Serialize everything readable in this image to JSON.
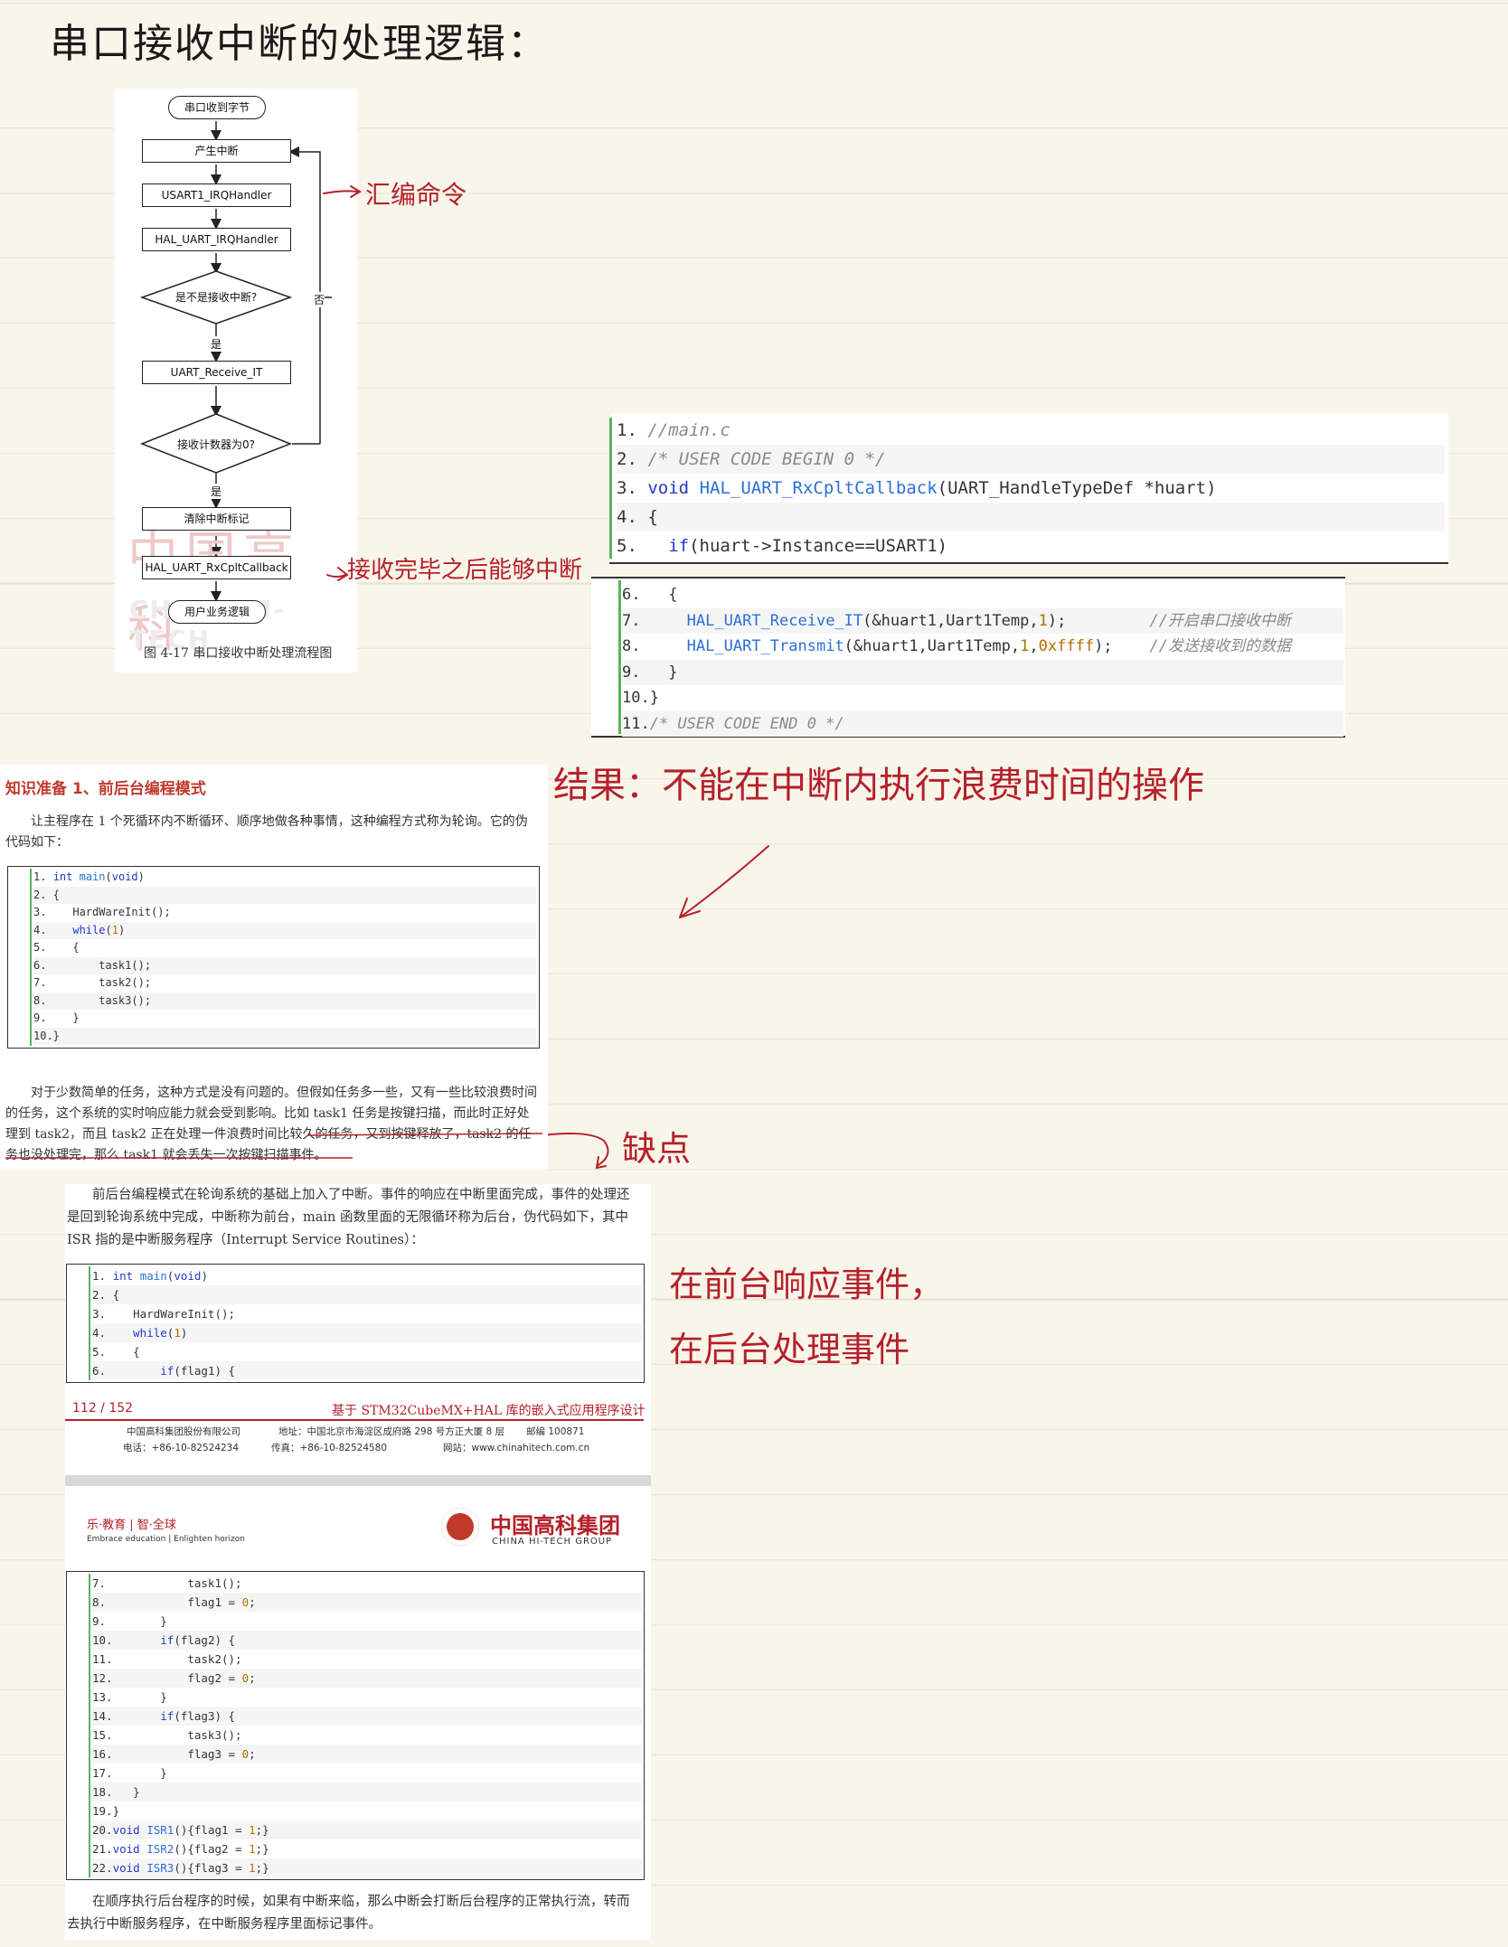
{
  "handwriting": {
    "title": "串口接收中断的处理逻辑：",
    "note_asm": "汇编命令",
    "note_callback": "接收完毕之后能够中断",
    "conclusion": "结果：不能在中断内执行浪费时间的操作",
    "note_cons": "缺点",
    "note_front": "在前台响应事件，",
    "note_back": "在后台处理事件"
  },
  "flowchart": {
    "nodes": [
      "串口收到字节",
      "产生中断",
      "USART1_IRQHandler",
      "HAL_UART_IRQHandler",
      "是不是接收中断?",
      "UART_Receive_IT",
      "接收计数器为0?",
      "清除中断标记",
      "HAL_UART_RxCpltCallback",
      "用户业务逻辑"
    ],
    "yes": "是",
    "no": "否",
    "caption": "图 4-17 串口接收中断处理流程图",
    "watermark1": "中国高科",
    "watermark2": "CHINA HI-TECH"
  },
  "code_main": {
    "lines": [
      {
        "n": "1.",
        "t": "//main.c"
      },
      {
        "n": "2.",
        "t": "/* USER CODE BEGIN 0 */"
      },
      {
        "n": "3.",
        "t": "void HAL_UART_RxCpltCallback(UART_HandleTypeDef *huart)"
      },
      {
        "n": "4.",
        "t": "{"
      },
      {
        "n": "5.",
        "t": "  if(huart->Instance==USART1)"
      },
      {
        "n": "6.",
        "t": "  {"
      },
      {
        "n": "7.",
        "t": "      HAL_UART_Receive_IT(&huart1,Uart1Temp,1);",
        "c": "//开启串口接收中断"
      },
      {
        "n": "8.",
        "t": "      HAL_UART_Transmit(&huart1,Uart1Temp,1,0xffff);",
        "c": "//发送接收到的数据"
      },
      {
        "n": "9.",
        "t": "  }"
      },
      {
        "n": "10.",
        "t": "}"
      },
      {
        "n": "11.",
        "t": "/* USER CODE END 0 */"
      }
    ]
  },
  "section": {
    "heading": "知识准备 1、前后台编程模式",
    "p1": "让主程序在 1 个死循环内不断循环、顺序地做各种事情，这种编程方式称为轮询。它的伪代码如下：",
    "p2": "对于少数简单的任务，这种方式是没有问题的。但假如任务多一些，又有一些比较浪费时间的任务，这个系统的实时响应能力就会受到影响。比如 task1 任务是按键扫描，而此时正好处理到 task2，而且 task2 正在处理一件浪费时间比较久的任务，又到按键释放了，task2 的任务也没处理完，那么 task1 就会丢失一次按键扫描事件。",
    "p3": "前后台编程模式在轮询系统的基础上加入了中断。事件的响应在中断里面完成，事件的处理还是回到轮询系统中完成，中断称为前台，main 函数里面的无限循环称为后台，伪代码如下，其中 ISR 指的是中断服务程序（Interrupt Service Routines）：",
    "p4": "在顺序执行后台程序的时候，如果有中断来临，那么中断会打断后台程序的正常执行流，转而去执行中断服务程序，在中断服务程序里面标记事件。"
  },
  "code_poll": [
    "1. int main(void)",
    "2. {",
    "3.    HardWareInit();",
    "4.    while(1)",
    "5.    {",
    "6.        task1();",
    "7.        task2();",
    "8.        task3();",
    "9.    }",
    "10.}"
  ],
  "code_fb1": [
    "1. int main(void)",
    "2. {",
    "3.    HardWareInit();",
    "4.    while(1)",
    "5.    {",
    "6.        if(flag1) {"
  ],
  "code_fb2": [
    "7.            task1();",
    "8.            flag1 = 0;",
    "9.        }",
    "10.       if(flag2) {",
    "11.           task2();",
    "12.           flag2 = 0;",
    "13.       }",
    "14.       if(flag3) {",
    "15.           task3();",
    "16.           flag3 = 0;",
    "17.       }",
    "18.   }",
    "19.}",
    "20.void ISR1(){flag1 = 1;}",
    "21.void ISR2(){flag2 = 1;}",
    "22.void ISR3(){flag3 = 1;}"
  ],
  "footer": {
    "page": "112 / 152",
    "book": "基于 STM32CubeMX+HAL 库的嵌入式应用程序设计",
    "company": "中国高科集团股份有限公司",
    "address": "地址：中国北京市海淀区成府路 298 号方正大厦 8 层",
    "postcode": "邮编 100871",
    "phone": "电话：+86-10-82524234",
    "fax": "传真：+86-10-82524580",
    "web": "网站：www.chinahitech.com.cn"
  },
  "header2": {
    "slogan": "乐·教育 | 智·全球",
    "slogan_en": "Embrace education | Enlighten horizon",
    "brand": "中国高科集团",
    "brand_en": "CHINA HI-TECH GROUP"
  }
}
